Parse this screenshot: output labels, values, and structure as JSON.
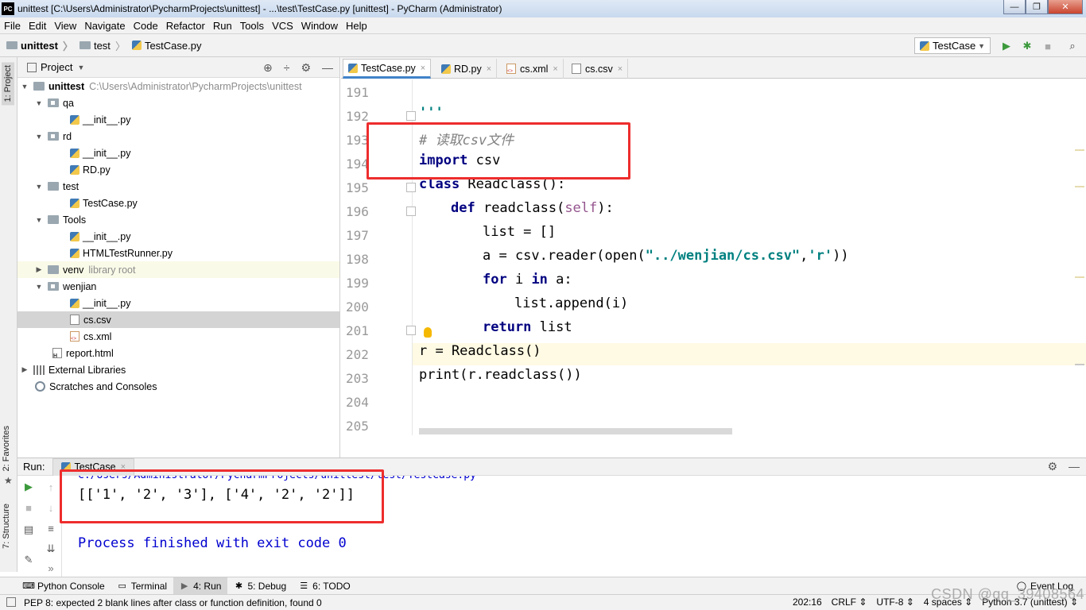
{
  "window": {
    "title": "unittest [C:\\Users\\Administrator\\PycharmProjects\\unittest] - ...\\test\\TestCase.py [unittest] - PyCharm (Administrator)",
    "app_badge": "PC"
  },
  "menu": [
    "File",
    "Edit",
    "View",
    "Navigate",
    "Code",
    "Refactor",
    "Run",
    "Tools",
    "VCS",
    "Window",
    "Help"
  ],
  "breadcrumb": [
    "unittest",
    "test",
    "TestCase.py"
  ],
  "run_config": "TestCase",
  "side_tabs": {
    "project": "1: Project",
    "favorites": "2: Favorites",
    "structure": "7: Structure"
  },
  "project_panel": {
    "title": "Project",
    "tree": [
      {
        "label": "unittest",
        "extra": "C:\\Users\\Administrator\\PycharmProjects\\unittest"
      },
      {
        "label": "qa"
      },
      {
        "label": "__init__.py"
      },
      {
        "label": "rd"
      },
      {
        "label": "__init__.py"
      },
      {
        "label": "RD.py"
      },
      {
        "label": "test"
      },
      {
        "label": "TestCase.py"
      },
      {
        "label": "Tools"
      },
      {
        "label": "__init__.py"
      },
      {
        "label": "HTMLTestRunner.py"
      },
      {
        "label": "venv",
        "extra": "library root"
      },
      {
        "label": "wenjian"
      },
      {
        "label": "__init__.py"
      },
      {
        "label": "cs.csv"
      },
      {
        "label": "cs.xml"
      },
      {
        "label": "report.html"
      },
      {
        "label": "External Libraries"
      },
      {
        "label": "Scratches and Consoles"
      }
    ]
  },
  "editor_tabs": [
    "TestCase.py",
    "RD.py",
    "cs.xml",
    "cs.csv"
  ],
  "editor": {
    "line_numbers": [
      "191",
      "192",
      "193",
      "194",
      "195",
      "196",
      "197",
      "198",
      "199",
      "200",
      "201",
      "202",
      "203",
      "204",
      "205"
    ],
    "code": {
      "l192": "'''",
      "l193_comment": "# 读取csv文件",
      "l194_kw": "import",
      "l194_rest": " csv",
      "l195_kw": "class",
      "l195_rest": " Readclass():",
      "l196_kw": "def",
      "l196_name": " readclass(",
      "l196_self": "self",
      "l196_end": "):",
      "l197": "list = []",
      "l198_a": "a = csv.reader(open(",
      "l198_str1": "\"../wenjian/cs.csv\"",
      "l198_comma": ",",
      "l198_str2": "'r'",
      "l198_end": "))",
      "l199_for": "for",
      "l199_mid": " i ",
      "l199_in": "in",
      "l199_end": " a:",
      "l200": "list.append(i)",
      "l201_kw": "return",
      "l201_rest": " list",
      "l202": "r = Readclass()",
      "l203": "print(r.readclass())"
    }
  },
  "run_panel": {
    "label": "Run:",
    "tab": "TestCase",
    "clipped_path": "C:/Users/Administrator/PycharmProjects/unittest/test/TestCase.py",
    "output": "[['1', '2', '3'], ['4', '2', '2']]",
    "finished": "Process finished with exit code 0"
  },
  "tool_windows": [
    "Python Console",
    "Terminal",
    "4: Run",
    "5: Debug",
    "6: TODO"
  ],
  "event_log": "Event Log",
  "status": {
    "message": "PEP 8: expected 2 blank lines after class or function definition, found 0",
    "position": "202:16",
    "line_sep": "CRLF ⇕",
    "encoding": "UTF-8 ⇕",
    "indent": "4 spaces ⇕",
    "interpreter": "Python 3.7 (unittest) ⇕"
  },
  "watermark": "CSDN @qq_39408564",
  "colors": {
    "highlight_box": "#ee2d2d",
    "current_line": "#fffae3",
    "keyword": "#000080",
    "string": "#008080",
    "output": "#0000d0"
  }
}
